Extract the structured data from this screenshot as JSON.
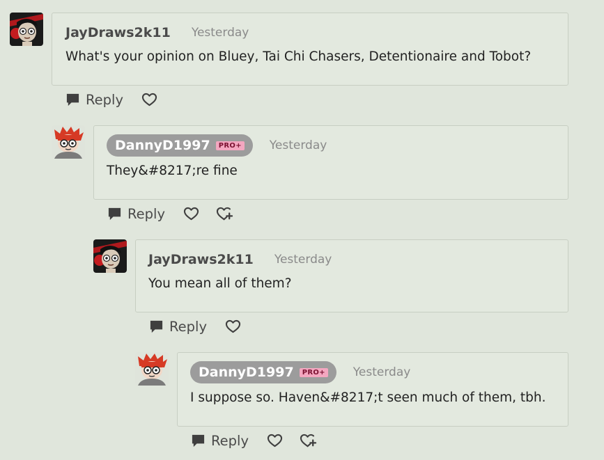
{
  "comments": [
    {
      "username": "JayDraws2k11",
      "timestamp": "Yesterday",
      "text": "What's your opinion on Bluey, Tai Chi Chasers, Detentionaire and Tobot?",
      "reply_label": "Reply",
      "pro_badge": null,
      "avatar": "jaydraws-avatar"
    },
    {
      "username": "DannyD1997",
      "timestamp": "Yesterday",
      "text": "They&#8217;re fine",
      "reply_label": "Reply",
      "pro_badge": "PRO+",
      "avatar": "dannyd-avatar"
    },
    {
      "username": "JayDraws2k11",
      "timestamp": "Yesterday",
      "text": "You mean all of them?",
      "reply_label": "Reply",
      "pro_badge": null,
      "avatar": "jaydraws-avatar"
    },
    {
      "username": "DannyD1997",
      "timestamp": "Yesterday",
      "text": "I suppose so. Haven&#8217;t seen much of them, tbh.",
      "reply_label": "Reply",
      "pro_badge": "PRO+",
      "avatar": "dannyd-avatar"
    }
  ],
  "icons": {
    "reply": "speech-bubble-icon",
    "favorite": "heart-icon",
    "give_llama": "heart-plus-icon"
  },
  "colors": {
    "background": "#e0e6dc",
    "pill": "#9c9c9c",
    "pro_badge": "#f4a7c0",
    "username": "#4a4a4a",
    "timestamp": "#8a8a8a"
  }
}
